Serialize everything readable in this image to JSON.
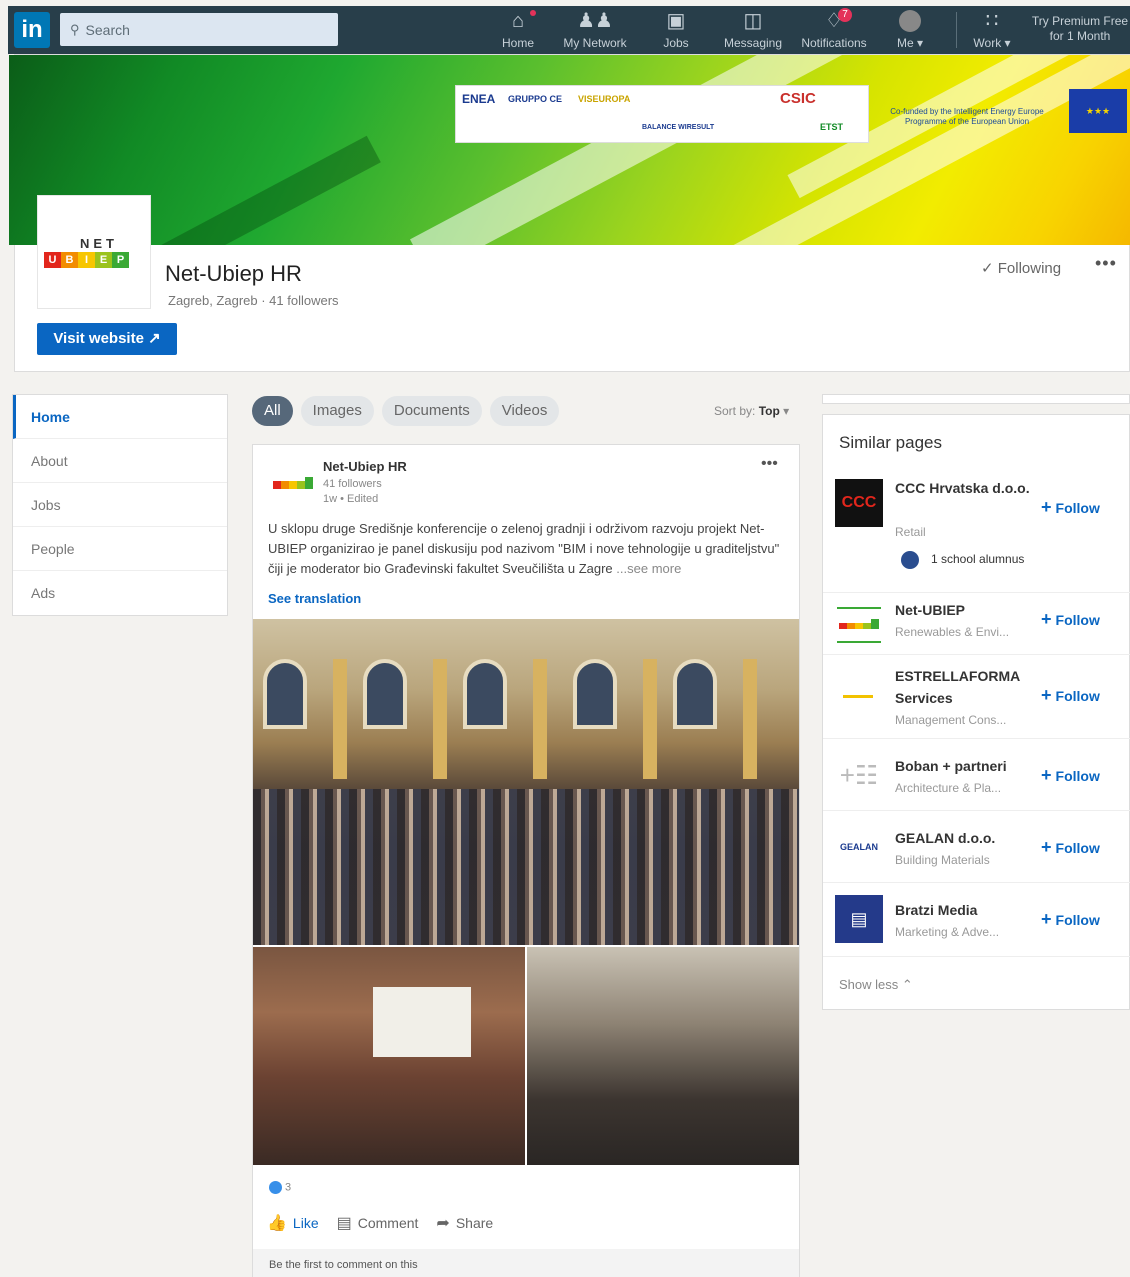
{
  "nav": {
    "search_placeholder": "Search",
    "items": [
      {
        "label": "Home",
        "icon": "home-icon",
        "badge": ""
      },
      {
        "label": "My Network",
        "icon": "network-icon",
        "badge": ""
      },
      {
        "label": "Jobs",
        "icon": "briefcase-icon",
        "badge": ""
      },
      {
        "label": "Messaging",
        "icon": "messaging-icon",
        "badge": ""
      },
      {
        "label": "Notifications",
        "icon": "bell-icon",
        "badge": "7"
      },
      {
        "label": "Me",
        "icon": "avatar-icon",
        "badge": ""
      },
      {
        "label": "Work",
        "icon": "grid-icon",
        "badge": ""
      }
    ],
    "premium_line1": "Try Premium Free",
    "premium_line2": "for 1 Month"
  },
  "banner": {
    "partners": [
      "ENEA",
      "GRUPPO CE",
      "VISEUROPA",
      "CSIC",
      "BALANCE WIRESULT",
      "ETST"
    ],
    "eu_text": "Co-funded by the Intelligent Energy Europe Programme of the European Union"
  },
  "company": {
    "logo_text": "NET",
    "logo_letters": [
      "U",
      "B",
      "I",
      "E",
      "P"
    ],
    "name": "Net-Ubiep HR",
    "subtitle": "Zagreb, Zagreb · 41 followers",
    "visit_website": "Visit website",
    "following": "Following",
    "more": "•••"
  },
  "left_menu": [
    "Home",
    "About",
    "Jobs",
    "People",
    "Ads"
  ],
  "filters": [
    "All",
    "Images",
    "Documents",
    "Videos"
  ],
  "sort": {
    "label": "Sort by:",
    "value": "Top"
  },
  "post": {
    "author": "Net-Ubiep HR",
    "followers": "41 followers",
    "time": "1w • Edited",
    "more": "•••",
    "text": "U sklopu druge Središnje konferencije o zelenoj gradnji i održivom razvoju projekt Net-UBIEP organizirao je panel diskusiju pod nazivom \"BIM i nove tehnologije u graditeljstvu\" čiji je moderator bio Građevinski fakultet Sveučilišta u Zagre",
    "see_more": "...see more",
    "see_translation": "See translation",
    "reaction_count": "3",
    "actions": {
      "like": "Like",
      "comment": "Comment",
      "share": "Share"
    },
    "comment_hint": "Be the first to comment on this"
  },
  "similar": {
    "title": "Similar pages",
    "items": [
      {
        "name": "CCC Hrvatska d.o.o.",
        "industry": "Retail",
        "follow": "Follow",
        "logo_text": "CCC"
      },
      {
        "name": "Net-UBIEP",
        "industry": "Renewables & Envi...",
        "follow": "Follow",
        "logo_text": ""
      },
      {
        "name": "ESTRELLAFORMA Services",
        "industry": "Management Cons...",
        "follow": "Follow",
        "logo_text": ""
      },
      {
        "name": "Boban + partneri",
        "industry": "Architecture & Pla...",
        "follow": "Follow",
        "logo_text": ""
      },
      {
        "name": "GEALAN d.o.o.",
        "industry": "Building Materials",
        "follow": "Follow",
        "logo_text": "GEALAN"
      },
      {
        "name": "Bratzi Media",
        "industry": "Marketing & Adve...",
        "follow": "Follow",
        "logo_text": ""
      }
    ],
    "alumnus": "1 school alumnus",
    "show_less": "Show less"
  },
  "colors": {
    "accent": "#0a66c2",
    "nav_bg": "#283e4a",
    "page_bg": "#f3f2ef"
  }
}
